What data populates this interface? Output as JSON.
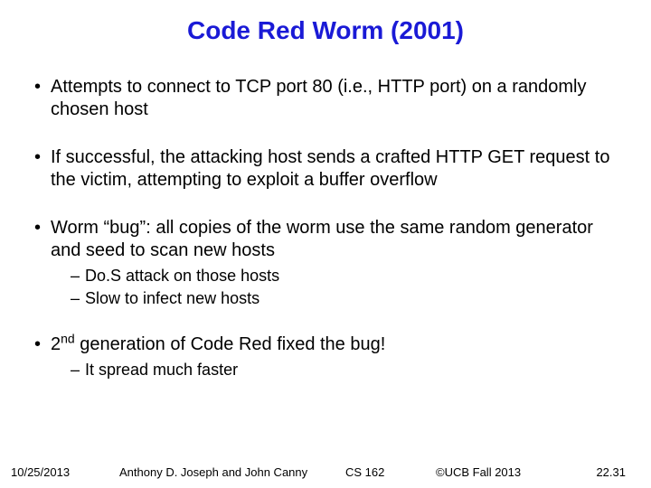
{
  "title": "Code Red Worm (2001)",
  "bullets": {
    "b1": "Attempts to connect to TCP port 80 (i.e., HTTP port) on a randomly chosen host",
    "b2": "If successful, the attacking host sends a crafted HTTP GET request to the victim, attempting to exploit a buffer overflow",
    "b3": "Worm “bug”: all copies of the worm use the same random generator and seed to scan new hosts",
    "b3_sub1": "Do.S attack on those hosts",
    "b3_sub2": "Slow to infect new hosts",
    "b4_pre": "2",
    "b4_sup": "nd",
    "b4_post": " generation of Code Red fixed the bug!",
    "b4_sub1": "It spread much faster"
  },
  "footer": {
    "date": "10/25/2013",
    "authors": "Anthony D. Joseph and John Canny",
    "course": "CS 162",
    "copyright": "©UCB Fall 2013",
    "page": "22.31"
  }
}
